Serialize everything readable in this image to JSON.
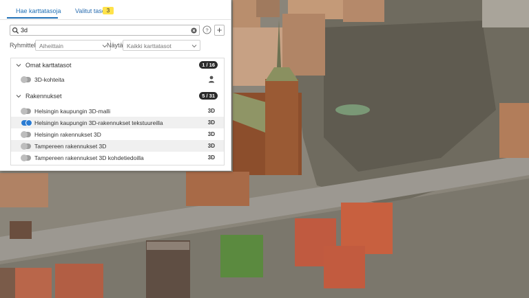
{
  "tabs": {
    "search_label": "Hae karttatasoja",
    "selected_label": "Valitut tasot",
    "selected_count": "3"
  },
  "search": {
    "value": "3d",
    "icon": "search-icon",
    "clear_icon": "close-circle-icon",
    "help_icon": "help-icon",
    "add_label": "+"
  },
  "filters": {
    "group_label": "Ryhmittely",
    "group_value": "Aiheittain",
    "show_label": "Näytä",
    "show_value": "Kaikki karttatasot"
  },
  "groups": [
    {
      "title": "Omat karttatasot",
      "count": "1 / 16",
      "layers": [
        {
          "name": "3D-kohteita",
          "type_icon": "user-icon",
          "enabled": false
        }
      ]
    },
    {
      "title": "Rakennukset",
      "count": "5 / 31",
      "layers": [
        {
          "name": "Helsingin kaupungin 3D-malli",
          "type": "3D",
          "enabled": false
        },
        {
          "name": "Helsingin kaupungin 3D-rakennukset tekstuureilla",
          "type": "3D",
          "enabled": true
        },
        {
          "name": "Helsingin rakennukset 3D",
          "type": "3D",
          "enabled": false
        },
        {
          "name": "Tampereen rakennukset 3D",
          "type": "3D",
          "enabled": false
        },
        {
          "name": "Tampereen rakennukset 3D kohdetiedoilla",
          "type": "3D",
          "enabled": false
        }
      ]
    }
  ],
  "colors": {
    "accent": "#2b7cd3",
    "badge_yellow": "#ffe24a",
    "count_badge": "#2b2b2b"
  }
}
